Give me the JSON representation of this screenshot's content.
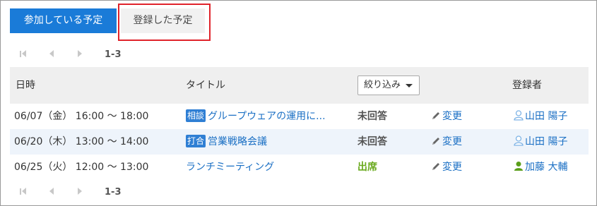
{
  "tabs": {
    "participating": "参加している予定",
    "registered": "登録した予定"
  },
  "pager": {
    "range_top": "1-3",
    "range_bottom": "1-3"
  },
  "table": {
    "headers": {
      "datetime": "日時",
      "title": "タイトル",
      "filter": "絞り込み",
      "registrant": "登録者"
    },
    "rows": [
      {
        "datetime": "06/07（金） 16:00 ～ 18:00",
        "tag": "相談",
        "title": "グループウェアの運用に...",
        "status": "未回答",
        "edit": "変更",
        "registrant": "山田 陽子"
      },
      {
        "datetime": "06/20（木） 13:00 ～ 14:00",
        "tag": "打合",
        "title": "営業戦略会議",
        "status": "未回答",
        "edit": "変更",
        "registrant": "山田 陽子"
      },
      {
        "datetime": "06/25（火） 12:00 ～ 13:00",
        "tag": "",
        "title": "ランチミーティング",
        "status": "出席",
        "edit": "変更",
        "registrant": "加藤 大輔"
      }
    ]
  },
  "colors": {
    "tab_active_bg": "#1a7bd8",
    "link": "#1a6fc4",
    "highlight_border": "#e0232b",
    "attend_status": "#6aaa1e",
    "user_icon_blue": "#7fb4e6",
    "user_icon_green": "#5a9e1a"
  },
  "icons": [
    "first-page-icon",
    "prev-page-icon",
    "next-page-icon",
    "pencil-icon",
    "user-icon",
    "caret-down-icon"
  ]
}
